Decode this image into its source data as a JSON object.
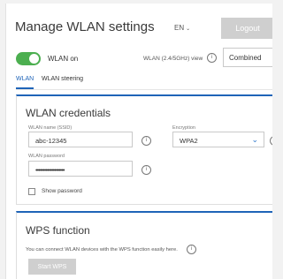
{
  "header": {
    "title": "Manage WLAN settings",
    "language": "EN",
    "language_chevron_icon": "chevron-down",
    "logout_label": "Logout"
  },
  "wlan": {
    "toggle_state": "on",
    "toggle_color": "#4caf50",
    "on_label": "WLAN on",
    "view_label": "WLAN (2.4/5GHz) view",
    "view_select_value": "Combined"
  },
  "tabs": [
    {
      "label": "WLAN",
      "active": true
    },
    {
      "label": "WLAN steering",
      "active": false
    }
  ],
  "credentials": {
    "title": "WLAN credentials",
    "ssid_label": "WLAN name (SSID)",
    "ssid_value": "abc-12345",
    "encryption_label": "Encryption",
    "encryption_value": "WPA2",
    "password_label": "WLAN password",
    "password_value": "••••••••••••••••••••",
    "show_password_label": "Show password",
    "show_password_checked": false
  },
  "wps": {
    "title": "WPS function",
    "description": "You can connect WLAN devices with the WPS function easily here.",
    "start_label": "Start WPS"
  },
  "colors": {
    "accent": "#1f64b8",
    "button_disabled": "#cfcfcf",
    "page_background": "#f2f2f2"
  },
  "icons": {
    "info": "info-circle-icon",
    "dropdown": "chevron-down-icon"
  }
}
